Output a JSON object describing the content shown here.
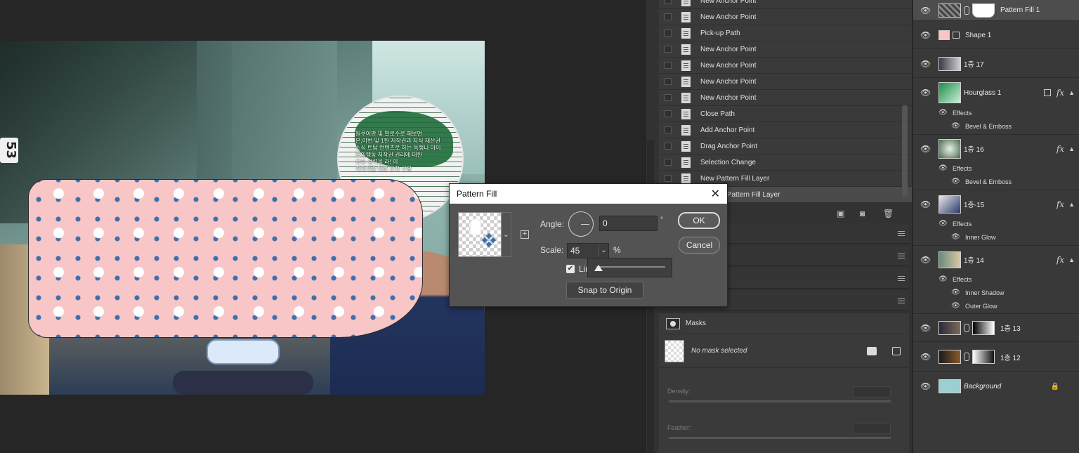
{
  "canvas": {
    "badge_number": "53",
    "globe_text": "원쿠어판 및 발로수로 해보면\n본,이번 및 1한 저작권과 지식 재산권\n소식 트탑 컨텐츠로 하는 독행나 아이\n폰의행동 저작권 권리에 대한\n보호 경력을 라! 이\n저작사랑 대한 오차 구분"
  },
  "history": {
    "items": [
      {
        "label": "New Anchor Point"
      },
      {
        "label": "New Anchor Point"
      },
      {
        "label": "Pick-up Path"
      },
      {
        "label": "New Anchor Point"
      },
      {
        "label": "New Anchor Point"
      },
      {
        "label": "New Anchor Point"
      },
      {
        "label": "New Anchor Point"
      },
      {
        "label": "Close Path"
      },
      {
        "label": "Add Anchor Point"
      },
      {
        "label": "Drag Anchor Point"
      },
      {
        "label": "Selection Change"
      },
      {
        "label": "New Pattern Fill Layer"
      },
      {
        "label": "Change Pattern Fill Layer"
      }
    ]
  },
  "masks": {
    "title": "Masks",
    "no_mask": "No mask selected",
    "density_label": "Density:",
    "feather_label": "Feather:"
  },
  "layers": {
    "items": [
      {
        "name": "Pattern Fill 1"
      },
      {
        "name": "Shape 1"
      },
      {
        "name": "1층 17"
      },
      {
        "name": "Hourglass 1"
      },
      {
        "name": "1층 16"
      },
      {
        "name": "1층-15"
      },
      {
        "name": "1층 14"
      },
      {
        "name": "1층 13"
      },
      {
        "name": "1층 12"
      },
      {
        "name": "Background"
      }
    ],
    "effects_label": "Effects",
    "effects": {
      "hourglass": [
        "Bevel & Emboss"
      ],
      "l16": [
        "Bevel & Emboss"
      ],
      "l15": [
        "Inner Glow"
      ],
      "l14": [
        "Inner Shadow",
        "Outer Glow"
      ]
    },
    "fx_label": "fx"
  },
  "dialog": {
    "title": "Pattern Fill",
    "angle_label": "Angle:",
    "angle_value": "0",
    "degree_symbol": "°",
    "scale_label": "Scale:",
    "scale_value": "45",
    "percent": "%",
    "link_label": "Link with Layer",
    "ok": "OK",
    "cancel": "Cancel",
    "snap": "Snap to Origin",
    "scale_fraction": 0.03
  },
  "colors": {
    "pattern_pink": "#f8c6c6",
    "pattern_blue": "#3d6fae"
  }
}
